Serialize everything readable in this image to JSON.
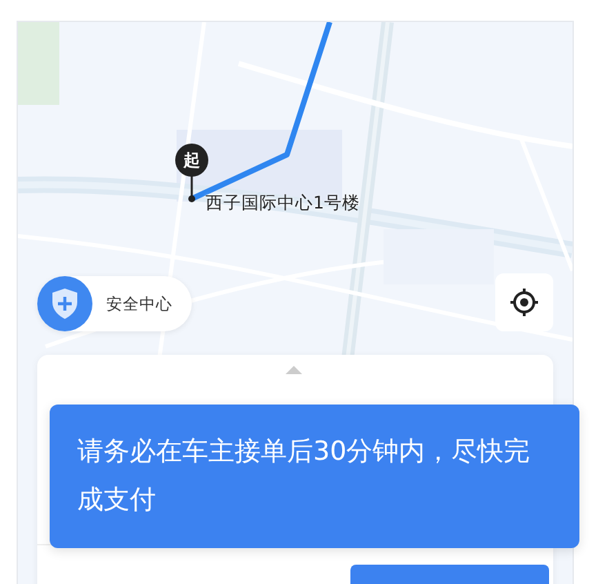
{
  "route": {
    "start_badge": "起",
    "start_label": "西子国际中心1号楼"
  },
  "safety_button": {
    "label": "安全中心"
  },
  "toast": {
    "message": "请务必在车主接单后30分钟内，尽快完成支付"
  }
}
